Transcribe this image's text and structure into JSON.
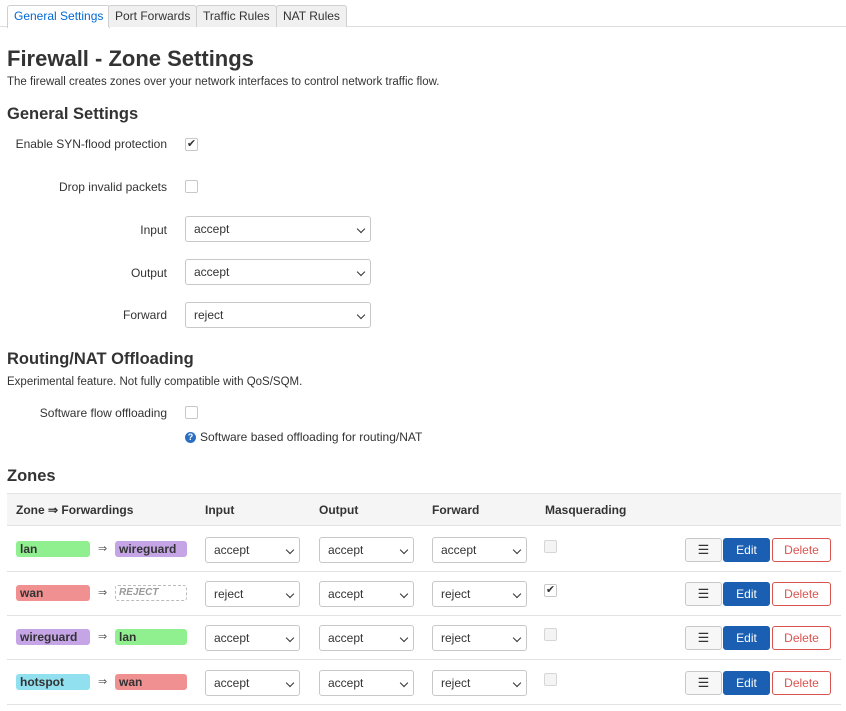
{
  "tabs": [
    {
      "label": "General Settings",
      "active": true
    },
    {
      "label": "Port Forwards",
      "active": false
    },
    {
      "label": "Traffic Rules",
      "active": false
    },
    {
      "label": "NAT Rules",
      "active": false
    }
  ],
  "page": {
    "title": "Firewall - Zone Settings",
    "description": "The firewall creates zones over your network interfaces to control network traffic flow."
  },
  "general": {
    "heading": "General Settings",
    "syn_flood": {
      "label": "Enable SYN-flood protection",
      "checked": true
    },
    "drop_invalid": {
      "label": "Drop invalid packets",
      "checked": false
    },
    "input": {
      "label": "Input",
      "value": "accept"
    },
    "output": {
      "label": "Output",
      "value": "accept"
    },
    "forward": {
      "label": "Forward",
      "value": "reject"
    }
  },
  "offloading": {
    "heading": "Routing/NAT Offloading",
    "description": "Experimental feature. Not fully compatible with QoS/SQM.",
    "software_flow": {
      "label": "Software flow offloading",
      "checked": false
    },
    "help": "Software based offloading for routing/NAT"
  },
  "zones": {
    "heading": "Zones",
    "columns": {
      "zone": "Zone ⇒ Forwardings",
      "input": "Input",
      "output": "Output",
      "forward": "Forward",
      "masq": "Masquerading"
    },
    "arrow": "⇒",
    "menu_label": "☰",
    "edit_label": "Edit",
    "delete_label": "Delete",
    "rows": [
      {
        "name": "lan",
        "name_color": "#90f090",
        "fwd": "wireguard",
        "fwd_color": "#c5a5e6",
        "input": "accept",
        "output": "accept",
        "forward": "accept",
        "masq": false
      },
      {
        "name": "wan",
        "name_color": "#f09090",
        "fwd": "REJECT",
        "fwd_color": "",
        "input": "reject",
        "output": "accept",
        "forward": "reject",
        "masq": true
      },
      {
        "name": "wireguard",
        "name_color": "#c5a5e6",
        "fwd": "lan",
        "fwd_color": "#90f090",
        "input": "accept",
        "output": "accept",
        "forward": "reject",
        "masq": false
      },
      {
        "name": "hotspot",
        "name_color": "#90e0f0",
        "fwd": "wan",
        "fwd_color": "#f09090",
        "input": "accept",
        "output": "accept",
        "forward": "reject",
        "masq": false
      }
    ]
  }
}
